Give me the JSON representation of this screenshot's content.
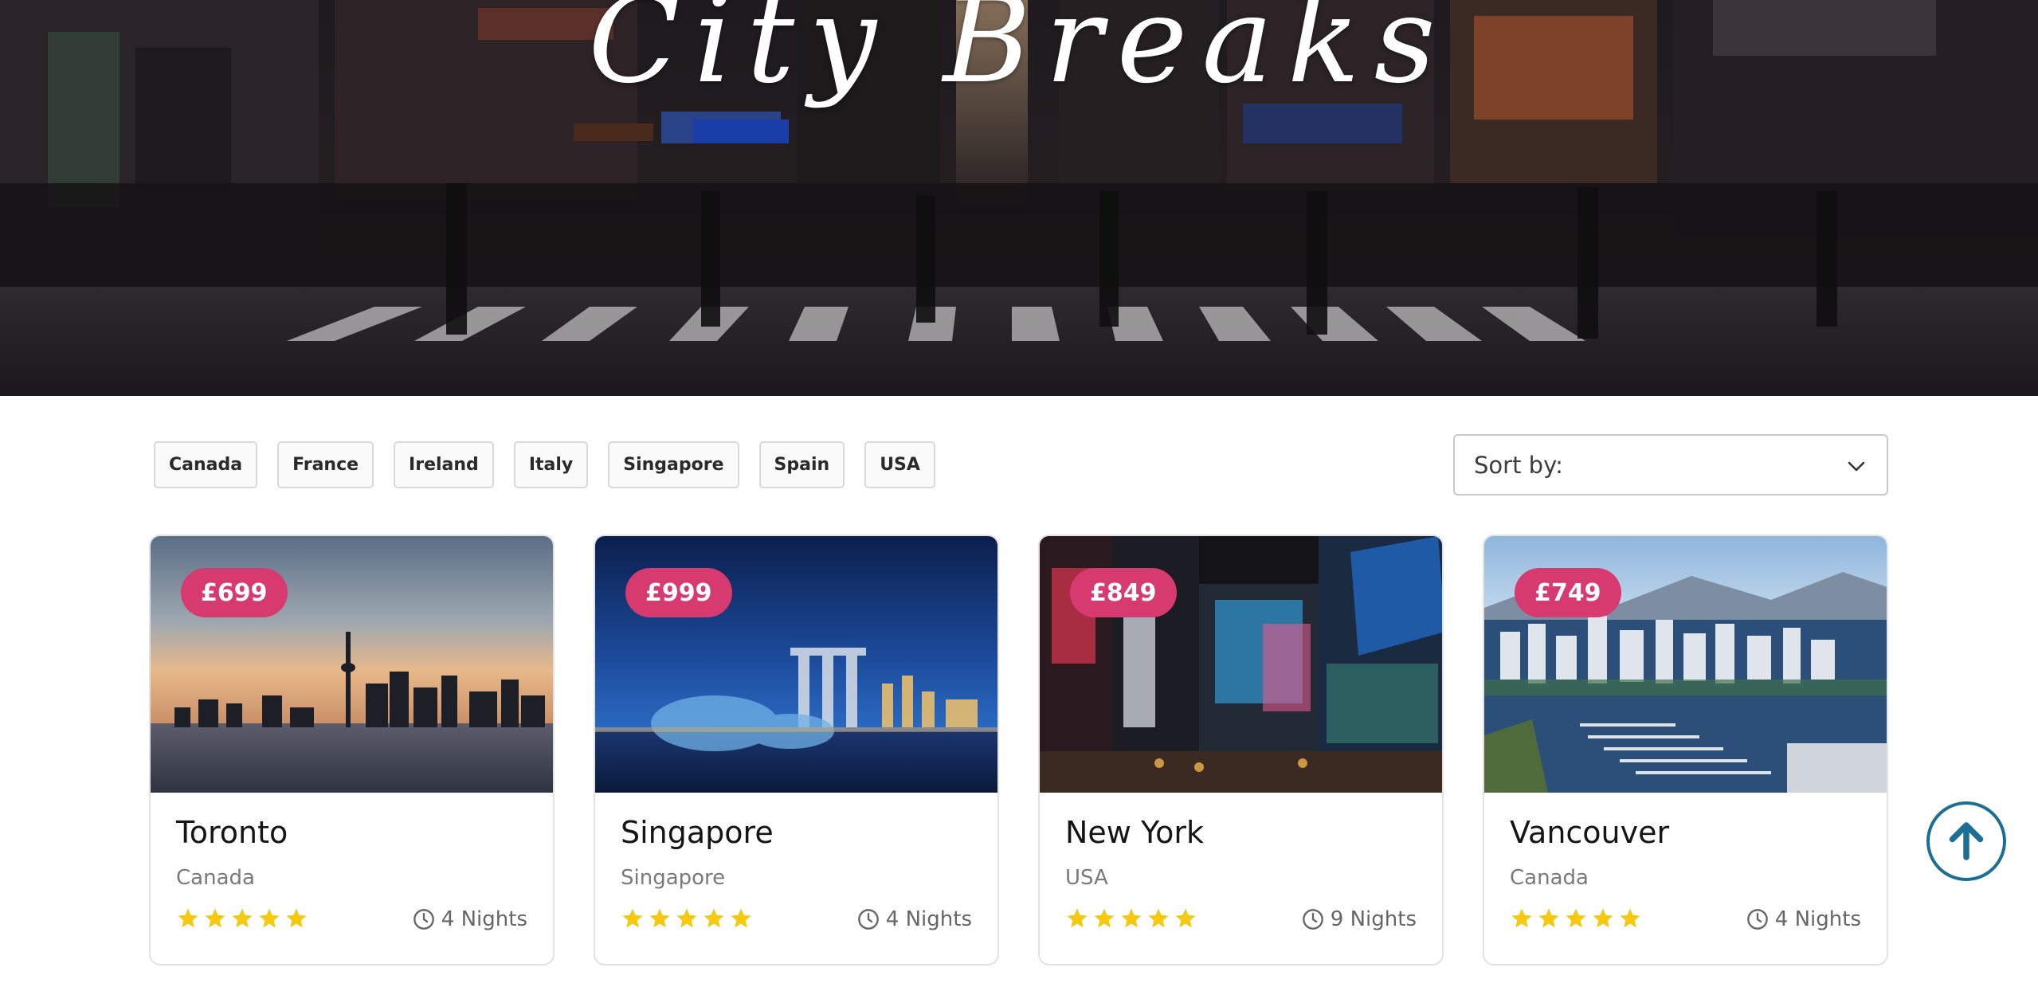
{
  "hero": {
    "title": "City Breaks"
  },
  "filters": {
    "countries": [
      "Canada",
      "France",
      "Ireland",
      "Italy",
      "Singapore",
      "Spain",
      "USA"
    ]
  },
  "sort": {
    "label": "Sort by:"
  },
  "cards": [
    {
      "price": "£699",
      "city": "Toronto",
      "country": "Canada",
      "rating": 5,
      "nights": "4 Nights"
    },
    {
      "price": "£999",
      "city": "Singapore",
      "country": "Singapore",
      "rating": 5,
      "nights": "4 Nights"
    },
    {
      "price": "£849",
      "city": "New York",
      "country": "USA",
      "rating": 5,
      "nights": "9 Nights"
    },
    {
      "price": "£749",
      "city": "Vancouver",
      "country": "Canada",
      "rating": 5,
      "nights": "4 Nights"
    }
  ],
  "colors": {
    "price_badge": "#d63a6e",
    "star": "#f6c90e",
    "back_to_top": "#1b6f92"
  },
  "icons": {
    "nights": "clock-icon",
    "sort": "chevron-down-icon",
    "back_to_top": "arrow-up-icon"
  }
}
